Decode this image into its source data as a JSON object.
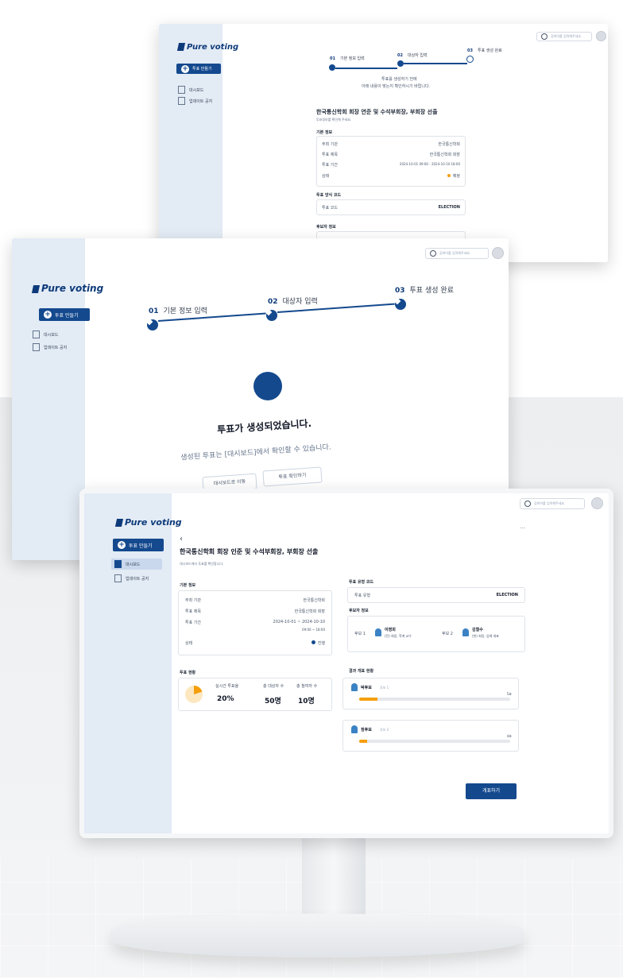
{
  "brand": "Pure voting",
  "screen_top": {
    "search_placeholder": "검색어를 입력해주세요.",
    "new_vote_button": "투표 만들기",
    "sidebar": [
      "대시보드",
      "업데이트 공지"
    ],
    "steps": [
      {
        "num": "01",
        "label": "기본 정보 입력"
      },
      {
        "num": "02",
        "label": "대상자 입력"
      },
      {
        "num": "03",
        "label": "투표 생성 완료"
      }
    ],
    "notice_line1": "투표를 생성하기 전에",
    "notice_line2": "아래 내용이 맞는지 확인하시기 바랍니다.",
    "vote_title": "한국통신학회 회장 연준 및 수석부회장, 부회장 선출",
    "vote_subtitle": "투표정보를 확인해 주세요.",
    "section_basic": "기본 정보",
    "basic_rows": [
      {
        "k": "주최 기관",
        "v": "한국통신학회"
      },
      {
        "k": "투표 제목",
        "v": "한국통신학회 회장"
      },
      {
        "k": "투표 기간",
        "v": "2024-10-01 09:00 - 2024-10-10 18:00"
      },
      {
        "k": "상태",
        "v": "예정"
      }
    ],
    "section_vote_method": "투표 방식 코드",
    "vote_method_key": "투표 코드",
    "vote_method_value": "ELECTION",
    "section_candidates": "후보자 정보"
  },
  "screen_middle": {
    "search_placeholder": "검색어를 입력해주세요.",
    "new_vote_button": "투표 만들기",
    "sidebar": [
      "대시보드",
      "업데이트 공지"
    ],
    "steps": [
      {
        "num": "01",
        "label": "기본 정보 입력"
      },
      {
        "num": "02",
        "label": "대상자 입력"
      },
      {
        "num": "03",
        "label": "투표 생성 완료"
      }
    ],
    "done_title": "투표가 생성되었습니다.",
    "done_desc": "생성된 투표는 [대시보드]에서 확인할 수 있습니다.",
    "btn_dashboard": "대시보드로 이동",
    "btn_check": "투표 확인하기"
  },
  "screen_bottom": {
    "search_placeholder": "검색어를 입력해주세요.",
    "new_vote_button": "투표 만들기",
    "sidebar": [
      "대시보드",
      "업데이트 공지"
    ],
    "back": "‹",
    "more": "···",
    "vote_title": "한국통신학회 회장 인준 및 수석부회장, 부회장 선출",
    "vote_subtitle": "대시보드에서 투표를 확인합니다.",
    "section_basic": "기본 정보",
    "basic_rows": [
      {
        "k": "주최 기관",
        "v": "한국통신학회"
      },
      {
        "k": "투표 제목",
        "v": "한국통신학회 회장"
      },
      {
        "k": "투표 기간",
        "v": "2024-10-01 ~ 2024-10-10"
      },
      {
        "k": "",
        "v": "09:00 ~ 18:00"
      },
      {
        "k": "상태",
        "v": "진행"
      }
    ],
    "section_vote_type": "투표 유형 코드",
    "vote_type_key": "투표 유형",
    "vote_type_value": "ELECTION",
    "section_candidates": "후보자 정보",
    "candidates": [
      {
        "tag": "후보 1",
        "name": "이영희",
        "desc": "(전) 회장, 학계 교수"
      },
      {
        "tag": "후보 2",
        "name": "김철수",
        "desc": "(현) 회장, 업계 대표"
      }
    ],
    "section_status": "투표 현황",
    "status_items": [
      {
        "label": "실시간 투표율",
        "value": "20%"
      },
      {
        "label": "총 대상자 수",
        "value": "50명"
      },
      {
        "label": "총 참여자 수",
        "value": "10명"
      }
    ],
    "turnout_fraction": 0.2,
    "section_results": "결과 개표 현황",
    "results": [
      {
        "name": "박후보",
        "sub": "후보 1",
        "count": "5표",
        "fraction": 0.12
      },
      {
        "name": "정후보",
        "sub": "후보 2",
        "count": "4표",
        "fraction": 0.05
      }
    ],
    "finish_button": "개표하기"
  },
  "colors": {
    "primary": "#14498e",
    "sidebar": "#e3ebf5",
    "accent": "#f59e0b"
  }
}
